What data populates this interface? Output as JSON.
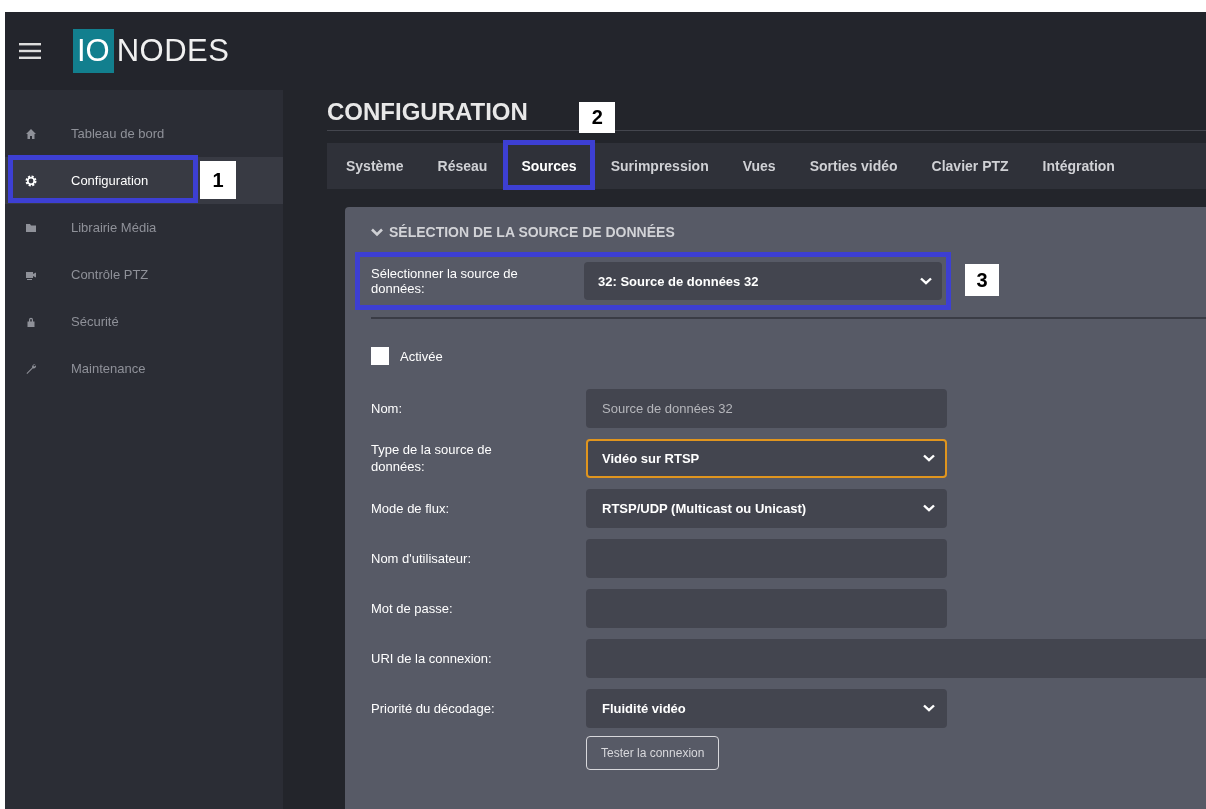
{
  "logo": {
    "mark": "IO",
    "text": "NODES"
  },
  "sidebar": {
    "items": [
      {
        "label": "Tableau de bord",
        "selected": false
      },
      {
        "label": "Configuration",
        "selected": true,
        "callout": "1"
      },
      {
        "label": "Librairie Média",
        "selected": false
      },
      {
        "label": "Contrôle PTZ",
        "selected": false
      },
      {
        "label": "Sécurité",
        "selected": false
      },
      {
        "label": "Maintenance",
        "selected": false
      }
    ]
  },
  "page_title": "CONFIGURATION",
  "tabs": [
    {
      "label": "Système",
      "selected": false
    },
    {
      "label": "Réseau",
      "selected": false
    },
    {
      "label": "Sources",
      "selected": true,
      "callout": "2"
    },
    {
      "label": "Surimpression",
      "selected": false
    },
    {
      "label": "Vues",
      "selected": false
    },
    {
      "label": "Sorties vidéo",
      "selected": false
    },
    {
      "label": "Clavier PTZ",
      "selected": false
    },
    {
      "label": "Intégration",
      "selected": false
    }
  ],
  "section": {
    "title": "SÉLECTION DE LA SOURCE DE DONNÉES",
    "expanded": true,
    "source_select": {
      "label": "Sélectionner la source de données:",
      "value": "32: Source de données 32",
      "callout": "3"
    },
    "form": [
      {
        "kind": "checkbox",
        "label": "Activée",
        "checked": false
      },
      {
        "kind": "text",
        "label": "Nom:",
        "placeholder": "Source de données 32"
      },
      {
        "kind": "select",
        "label": "Type de la source de données:",
        "value": "Vidéo sur RTSP",
        "focused": true
      },
      {
        "kind": "select",
        "label": "Mode de flux:",
        "value": "RTSP/UDP (Multicast ou Unicast)",
        "focused": false
      },
      {
        "kind": "text",
        "label": "Nom d'utilisateur:"
      },
      {
        "kind": "text",
        "label": "Mot de passe:"
      },
      {
        "kind": "wide_text",
        "label": "URI de la connexion:"
      },
      {
        "kind": "select",
        "label": "Priorité du décodage:",
        "value": "Fluidité vidéo",
        "focused": false
      },
      {
        "kind": "button",
        "label": "Tester la connexion"
      }
    ]
  }
}
